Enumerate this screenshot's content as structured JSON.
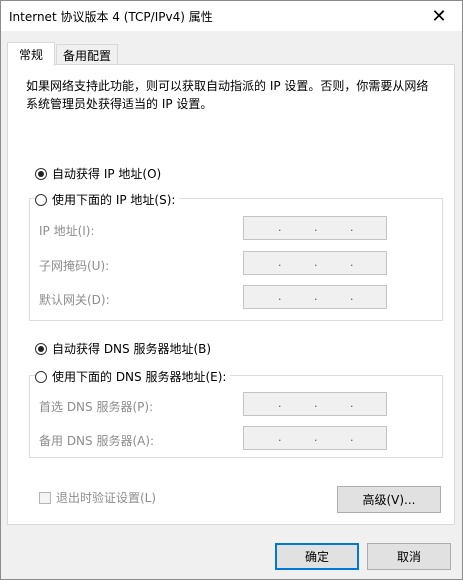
{
  "window": {
    "title": "Internet 协议版本 4 (TCP/IPv4) 属性",
    "close": "✕"
  },
  "tabs": [
    {
      "label": "常规"
    },
    {
      "label": "备用配置"
    }
  ],
  "description": "如果网络支持此功能，则可以获取自动指派的 IP 设置。否则，你需要从网络系统管理员处获得适当的 IP 设置。",
  "ip": {
    "auto_label": "自动获得 IP 地址(O)",
    "manual_label": "使用下面的 IP 地址(S):",
    "fields": [
      {
        "label": "IP 地址(I):"
      },
      {
        "label": "子网掩码(U):"
      },
      {
        "label": "默认网关(D):"
      }
    ]
  },
  "dns": {
    "auto_label": "自动获得 DNS 服务器地址(B)",
    "manual_label": "使用下面的 DNS 服务器地址(E):",
    "fields": [
      {
        "label": "首选 DNS 服务器(P):"
      },
      {
        "label": "备用 DNS 服务器(A):"
      }
    ]
  },
  "validate_label": "退出时验证设置(L)",
  "advanced_label": "高级(V)...",
  "ok_label": "确定",
  "cancel_label": "取消",
  "ip_separator": "."
}
